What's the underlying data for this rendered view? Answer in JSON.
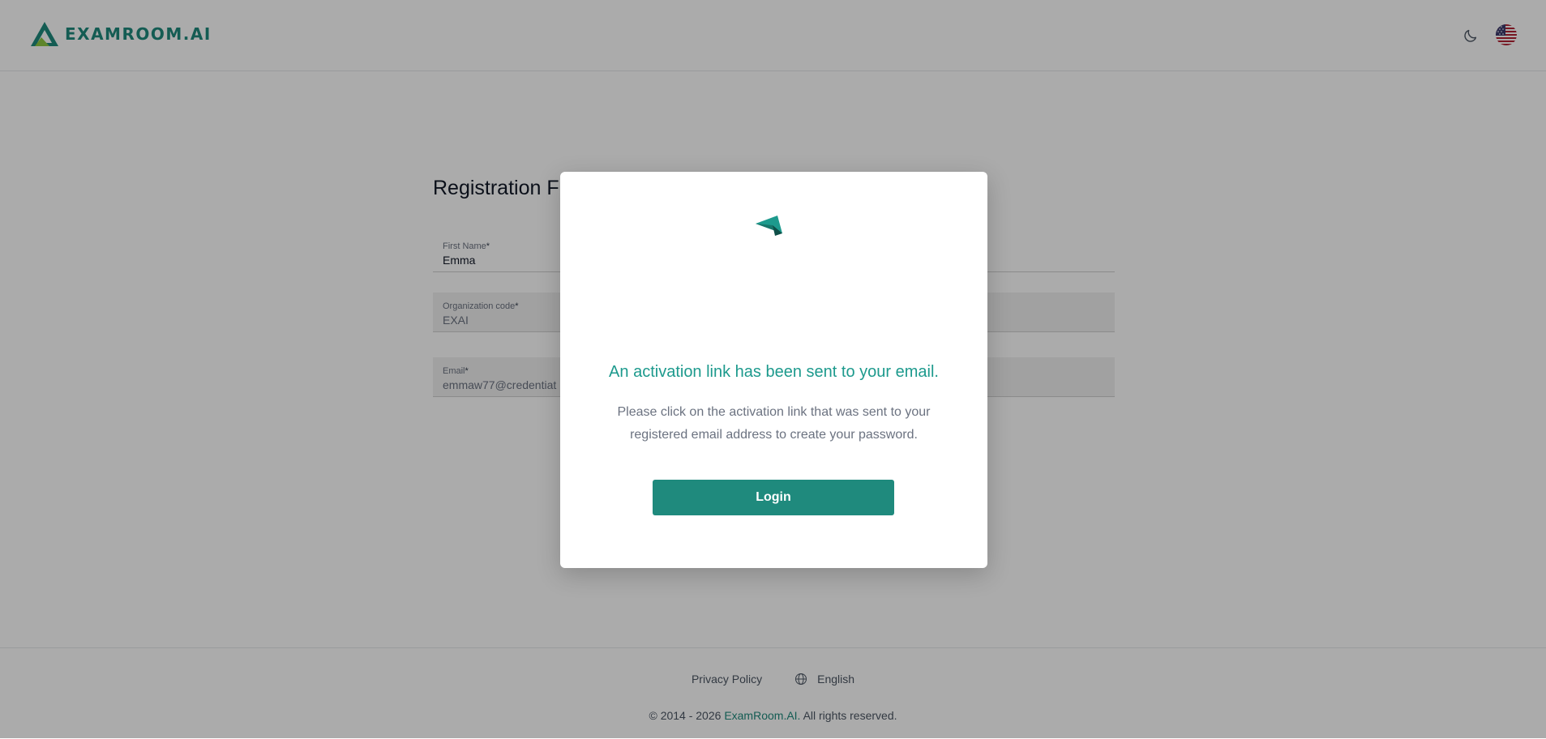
{
  "header": {
    "logo_text": "EXAMROOM.AI",
    "theme_icon": "moon-icon",
    "language_icon": "us-flag-icon"
  },
  "form": {
    "title": "Registration F",
    "fields": [
      {
        "label": "First Name",
        "required_mark": "*",
        "value": "Emma",
        "disabled": false
      },
      {
        "label": "Organization code",
        "required_mark": "*",
        "value": "EXAI",
        "disabled": true
      },
      {
        "label": "Email",
        "required_mark": "*",
        "value": "emmaw77@credentiat",
        "disabled": true
      }
    ]
  },
  "modal": {
    "icon": "paper-plane-icon",
    "title": "An activation link has been sent to your email.",
    "message": "Please click on the activation link that was sent to your registered email address to create your password.",
    "button_label": "Login"
  },
  "footer": {
    "privacy_label": "Privacy Policy",
    "language_label": "English",
    "language_icon": "globe-icon",
    "copyright_prefix": "© 2014 - 2026 ",
    "copyright_brand": "ExamRoom.AI.",
    "copyright_suffix": " All rights reserved."
  },
  "colors": {
    "brand": "#1f8a7d",
    "accent_text": "#1d9a8d",
    "overlay": "rgba(0,0,0,0.33)"
  }
}
